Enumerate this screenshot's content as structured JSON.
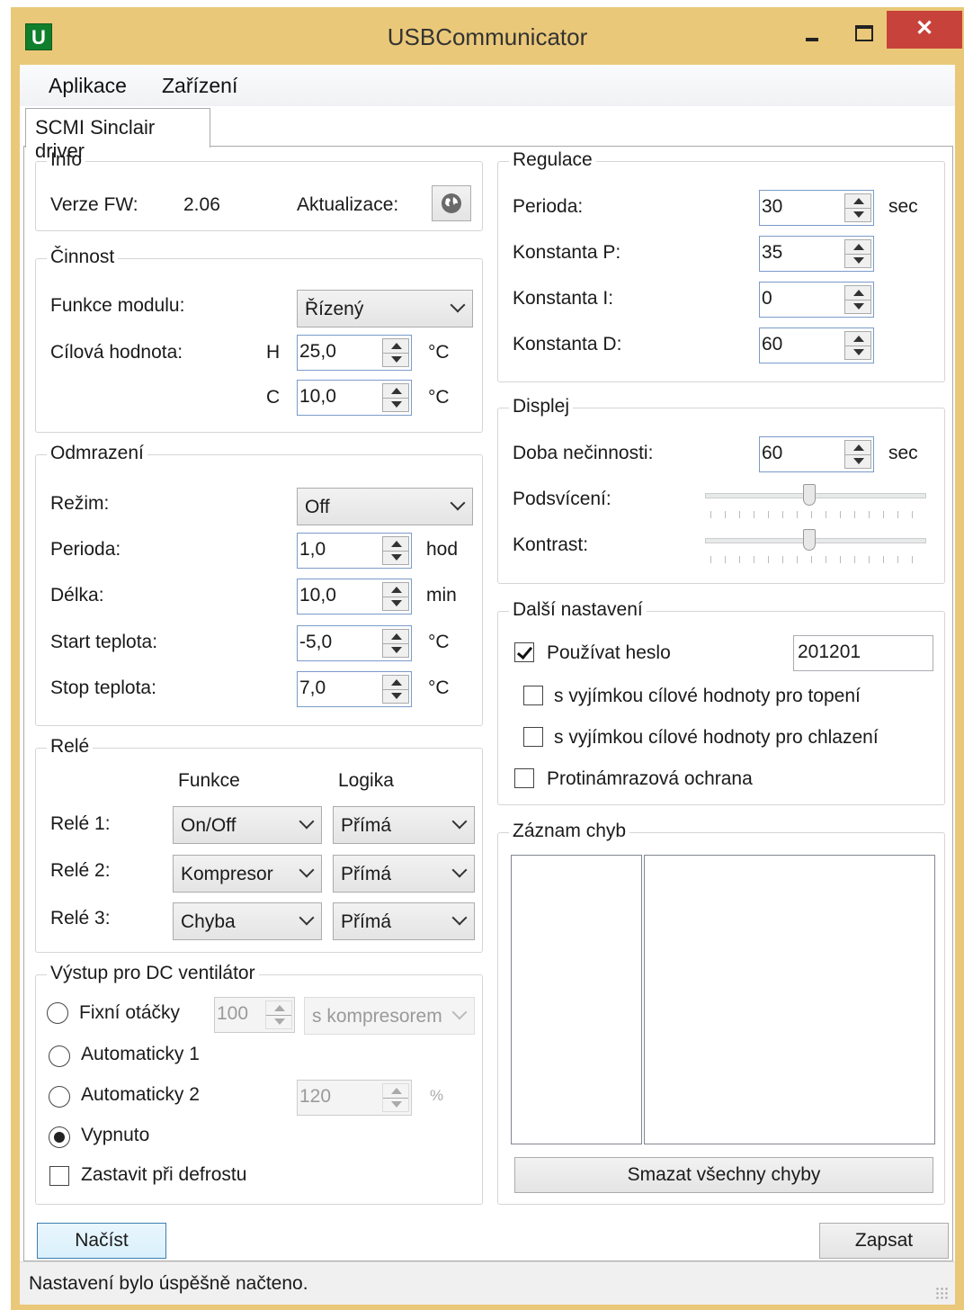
{
  "window": {
    "title": "USBCommunicator",
    "icon_letter": "U",
    "close_glyph": "✕"
  },
  "menu": {
    "items": [
      "Aplikace",
      "Zařízení"
    ]
  },
  "tab": {
    "label": "SCMI Sinclair driver"
  },
  "info": {
    "legend": "Info",
    "fw_label": "Verze FW:",
    "fw_value": "2.06",
    "update_label": "Aktualizace:",
    "update_icon": "globe-icon"
  },
  "cinnost": {
    "legend": "Činnost",
    "funkce_label": "Funkce modulu:",
    "funkce_value": "Řízený",
    "cilova_label": "Cílová hodnota:",
    "h_label": "H",
    "h_value": "25,0",
    "c_label": "C",
    "c_value": "10,0",
    "unit": "°C"
  },
  "odmrazeni": {
    "legend": "Odmrazení",
    "rezim_label": "Režim:",
    "rezim_value": "Off",
    "perioda_label": "Perioda:",
    "perioda_value": "1,0",
    "perioda_unit": "hod",
    "delka_label": "Délka:",
    "delka_value": "10,0",
    "delka_unit": "min",
    "start_label": "Start teplota:",
    "start_value": "-5,0",
    "start_unit": "°C",
    "stop_label": "Stop teplota:",
    "stop_value": "7,0",
    "stop_unit": "°C"
  },
  "rele": {
    "legend": "Relé",
    "col_funkce": "Funkce",
    "col_logika": "Logika",
    "rows": [
      {
        "label": "Relé 1:",
        "funkce": "On/Off",
        "logika": "Přímá"
      },
      {
        "label": "Relé 2:",
        "funkce": "Kompresor",
        "logika": "Přímá"
      },
      {
        "label": "Relé 3:",
        "funkce": "Chyba",
        "logika": "Přímá"
      }
    ]
  },
  "ventilator": {
    "legend": "Výstup pro DC ventilátor",
    "fixni_label": "Fixní otáčky",
    "fixni_value": "100",
    "fixni_mode": "s kompresorem",
    "auto1_label": "Automaticky 1",
    "auto2_label": "Automaticky 2",
    "auto2_value": "120",
    "auto2_unit": "%",
    "vypnuto_label": "Vypnuto",
    "zastavit_label": "Zastavit při defrostu",
    "selected": "Vypnuto",
    "zastavit_checked": false
  },
  "regulace": {
    "legend": "Regulace",
    "perioda_label": "Perioda:",
    "perioda_value": "30",
    "perioda_unit": "sec",
    "p_label": "Konstanta P:",
    "p_value": "35",
    "i_label": "Konstanta I:",
    "i_value": "0",
    "d_label": "Konstanta D:",
    "d_value": "60"
  },
  "displej": {
    "legend": "Displej",
    "doba_label": "Doba nečinnosti:",
    "doba_value": "60",
    "doba_unit": "sec",
    "podsviceni_label": "Podsvícení:",
    "podsviceni_level": 0.47,
    "kontrast_label": "Kontrast:",
    "kontrast_level": 0.47
  },
  "dalsi": {
    "legend": "Další nastavení",
    "heslo_label": "Používat heslo",
    "heslo_checked": true,
    "heslo_value": "201201",
    "topeni_label": "s vyjímkou cílové hodnoty pro topení",
    "topeni_checked": false,
    "chlazeni_label": "s vyjímkou cílové hodnoty pro chlazení",
    "chlazeni_checked": false,
    "protimraz_label": "Protinámrazová ochrana",
    "protimraz_checked": false
  },
  "zaznam": {
    "legend": "Záznam chyb",
    "clear_label": "Smazat všechny chyby"
  },
  "buttons": {
    "nacist": "Načíst",
    "zapsat": "Zapsat"
  },
  "status": {
    "text": "Nastavení bylo úspěšně načteno."
  },
  "colors": {
    "titlebar": "#eac879",
    "close": "#c7423a",
    "app_icon": "#0f7f2c"
  }
}
